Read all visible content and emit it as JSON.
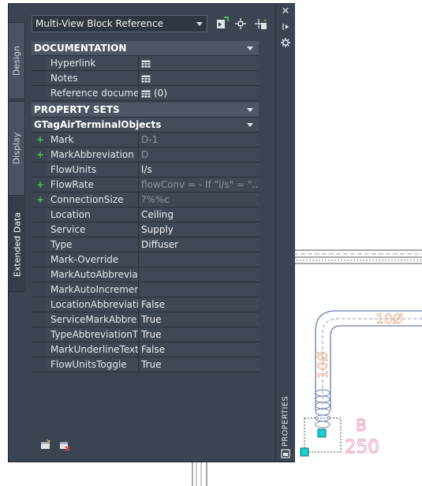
{
  "palette": {
    "tabs": [
      {
        "label": "Design"
      },
      {
        "label": "Display"
      },
      {
        "label": "Extended Data"
      }
    ],
    "strip_title": "PROPERTIES",
    "style_dropdown": {
      "value": "Multi-View Block Reference"
    },
    "sections": {
      "documentation": {
        "title": "DOCUMENTATION",
        "rows": [
          {
            "name": "Hyperlink",
            "value": ""
          },
          {
            "name": "Notes",
            "value": ""
          },
          {
            "name": "Reference docume...",
            "value": "(0)"
          }
        ]
      },
      "property_sets": {
        "title": "PROPERTY SETS",
        "group": "GTagAirTerminalObjects",
        "rows": [
          {
            "name": "Mark",
            "value": "D-1"
          },
          {
            "name": "MarkAbbreviation",
            "value": "D"
          },
          {
            "name": "FlowUnits",
            "value": "l/s"
          },
          {
            "name": "FlowRate",
            "value": "flowConv = - If \"l/s\" = \"..."
          },
          {
            "name": "ConnectionSize",
            "value": "?%%c"
          },
          {
            "name": "Location",
            "value": "Ceiling"
          },
          {
            "name": "Service",
            "value": "Supply"
          },
          {
            "name": "Type",
            "value": "Diffuser"
          },
          {
            "name": "Mark-Override",
            "value": ""
          },
          {
            "name": "MarkAutoAbbrevia...",
            "value": ""
          },
          {
            "name": "MarkAutoIncremen...",
            "value": ""
          },
          {
            "name": "LocationAbbreviati...",
            "value": "False"
          },
          {
            "name": "ServiceMarkAbbre...",
            "value": "True"
          },
          {
            "name": "TypeAbbreviationT...",
            "value": "True"
          },
          {
            "name": "MarkUnderlineText...",
            "value": "False"
          },
          {
            "name": "FlowUnitsToggle",
            "value": "True"
          }
        ]
      }
    }
  },
  "drawing": {
    "duct_label_horizontal": "10Ø",
    "duct_label_vertical": "10Ø",
    "tag_mark": "B",
    "tag_value": "250"
  },
  "colors": {
    "palette_bg": "#3b4453",
    "duct_line": "#6b7ea8",
    "tag_text": "#e38bb6",
    "grip": "#18d0d0",
    "plus": "#4cc04c"
  }
}
